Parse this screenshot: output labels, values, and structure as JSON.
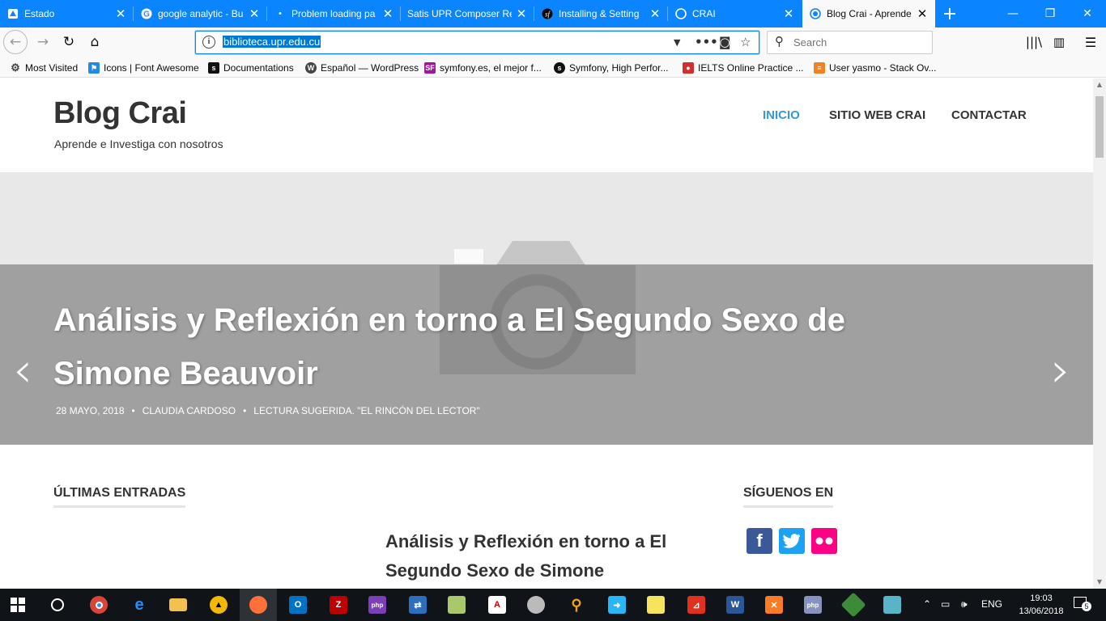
{
  "browser": {
    "tabs": [
      {
        "title": "Estado",
        "favicon": "gitlab-icon",
        "color": "#e24329"
      },
      {
        "title": "google analytic - Bu",
        "favicon": "google-icon",
        "color": "#4285f4"
      },
      {
        "title": "Problem loading pa",
        "favicon": "dot-icon",
        "color": "#ffffff"
      },
      {
        "title": "Satis UPR Composer Rep",
        "favicon": "none",
        "color": "#ffffff"
      },
      {
        "title": "Installing & Setting",
        "favicon": "symfony-icon",
        "color": "#000000"
      },
      {
        "title": "CRAI",
        "favicon": "globe-icon",
        "color": "#0a84ff"
      },
      {
        "title": "Blog Crai - Aprende",
        "favicon": "globe-icon",
        "color": "#0a84ff"
      }
    ],
    "url": "biblioteca.upr.edu.cu",
    "search_placeholder": "Search",
    "bookmarks": [
      {
        "label": "Most Visited",
        "icon": "gear-icon",
        "color": "#444444"
      },
      {
        "label": "Icons | Font Awesome",
        "icon": "flag-icon",
        "color": "#228ae6"
      },
      {
        "label": "Documentations",
        "icon": "symfony-icon",
        "color": "#111111"
      },
      {
        "label": "Español — WordPress",
        "icon": "wordpress-icon",
        "color": "#464646"
      },
      {
        "label": "symfony.es, el mejor f...",
        "icon": "sf-icon",
        "color": "#a3169a"
      },
      {
        "label": "Symfony, High Perfor...",
        "icon": "symfony-icon",
        "color": "#111111"
      },
      {
        "label": "IELTS Online Practice ...",
        "icon": "ielts-icon",
        "color": "#d0312d"
      },
      {
        "label": "User yasmo - Stack Ov...",
        "icon": "stackoverflow-icon",
        "color": "#f48024"
      }
    ]
  },
  "site": {
    "title": "Blog Crai",
    "tagline": "Aprende e Investiga con nosotros",
    "nav": [
      "INICIO",
      "SITIO WEB CRAI",
      "CONTACTAR"
    ],
    "accent": "#3498db"
  },
  "hero": {
    "title": "Análisis y Reflexión en torno a El Segundo Sexo de Simone Beauvoir",
    "date": "28 MAYO, 2018",
    "author": "CLAUDIA CARDOSO",
    "category": "LECTURA SUGERIDA. \"EL RINCÓN DEL LECTOR\"",
    "separator": "•",
    "prev": "‹",
    "next": "›"
  },
  "sections": {
    "latest": "ÚLTIMAS ENTRADAS",
    "follow": "SÍGUENOS EN"
  },
  "post": {
    "title": "Análisis y Reflexión en torno a El Segundo Sexo de Simone"
  },
  "social": [
    {
      "name": "facebook",
      "glyph": "f",
      "color": "#3b5998"
    },
    {
      "name": "twitter",
      "glyph": "t",
      "color": "#1da1f2"
    },
    {
      "name": "flickr",
      "glyph": "••",
      "color": "#ff0084"
    }
  ],
  "taskbar": {
    "time": "19:03",
    "date": "13/06/2018",
    "lang": "ENG",
    "notifications": "5"
  }
}
